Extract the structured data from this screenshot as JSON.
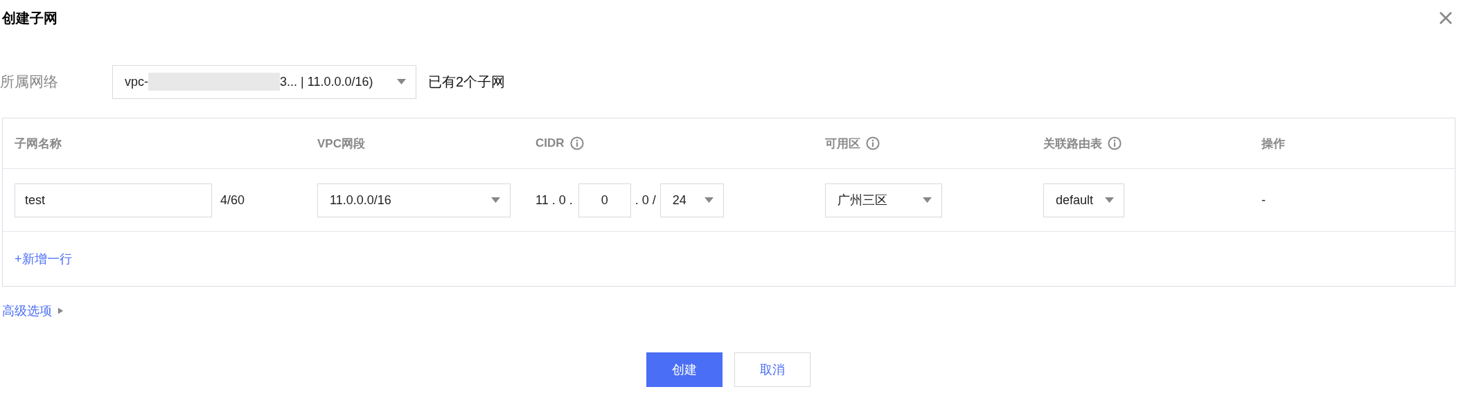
{
  "dialog": {
    "title": "创建子网"
  },
  "network": {
    "label": "所属网络",
    "value_start": "vpc-",
    "redacted": true,
    "value_end": "3... | 11.0.0.0/16)",
    "note": "已有2个子网"
  },
  "table": {
    "columns": [
      {
        "label": "子网名称",
        "info": false
      },
      {
        "label": "VPC网段",
        "info": false
      },
      {
        "label": "CIDR",
        "info": true
      },
      {
        "label": "可用区",
        "info": true
      },
      {
        "label": "关联路由表",
        "info": true
      },
      {
        "label": "操作",
        "info": false
      }
    ],
    "rows": [
      {
        "name": "test",
        "count": "4/60",
        "vpc_range": "11.0.0.0/16",
        "cidr_prefix": "11 . 0 .",
        "cidr_octet": "0",
        "cidr_suffix": ". 0 /",
        "cidr_mask": "24",
        "zone": "广州三区",
        "route_table": "default",
        "action": "-"
      }
    ],
    "add_row": "+新增一行"
  },
  "advanced": {
    "label": "高级选项",
    "expanded": false
  },
  "buttons": [
    {
      "label": "创建",
      "kind": "primary"
    },
    {
      "label": "取消",
      "kind": "secondary"
    }
  ]
}
